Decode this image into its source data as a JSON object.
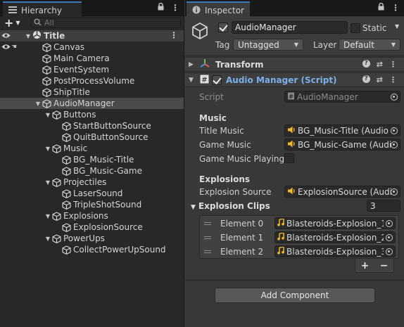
{
  "hierarchy": {
    "tab_label": "Hierarchy",
    "search_placeholder": "All",
    "plus_label": "+",
    "root": "Title",
    "items": [
      {
        "label": "Canvas",
        "depth": 1,
        "expanded": null
      },
      {
        "label": "Main Camera",
        "depth": 1,
        "expanded": null
      },
      {
        "label": "EventSystem",
        "depth": 1,
        "expanded": null
      },
      {
        "label": "PostProcessVolume",
        "depth": 1,
        "expanded": null
      },
      {
        "label": "ShipTitle",
        "depth": 1,
        "expanded": null
      },
      {
        "label": "AudioManager",
        "depth": 1,
        "expanded": true,
        "selected": true
      },
      {
        "label": "Buttons",
        "depth": 2,
        "expanded": true
      },
      {
        "label": "StartButtonSource",
        "depth": 3,
        "expanded": null
      },
      {
        "label": "QuitButtonSource",
        "depth": 3,
        "expanded": null
      },
      {
        "label": "Music",
        "depth": 2,
        "expanded": true
      },
      {
        "label": "BG_Music-Title",
        "depth": 3,
        "expanded": null
      },
      {
        "label": "BG_Music-Game",
        "depth": 3,
        "expanded": null
      },
      {
        "label": "Projectiles",
        "depth": 2,
        "expanded": true
      },
      {
        "label": "LaserSound",
        "depth": 3,
        "expanded": null
      },
      {
        "label": "TripleShotSound",
        "depth": 3,
        "expanded": null
      },
      {
        "label": "Explosions",
        "depth": 2,
        "expanded": true
      },
      {
        "label": "ExplosionSource",
        "depth": 3,
        "expanded": null
      },
      {
        "label": "PowerUps",
        "depth": 2,
        "expanded": true
      },
      {
        "label": "CollectPowerUpSound",
        "depth": 3,
        "expanded": null
      }
    ]
  },
  "inspector": {
    "tab_label": "Inspector",
    "object_name": "AudioManager",
    "static_label": "Static",
    "tag_label": "Tag",
    "tag_value": "Untagged",
    "layer_label": "Layer",
    "layer_value": "Default",
    "transform_label": "Transform",
    "script_component_label": "Audio Manager (Script)",
    "script_label": "Script",
    "script_value": "AudioManager",
    "music_header": "Music",
    "title_music_label": "Title Music",
    "title_music_value": "BG_Music-Title (Audio S",
    "game_music_label": "Game Music",
    "game_music_value": "BG_Music-Game (Audic",
    "game_music_playing_label": "Game Music Playing",
    "explosions_header": "Explosions",
    "explosion_source_label": "Explosion Source",
    "explosion_source_value": "ExplosionSource (Audio",
    "explosion_clips_label": "Explosion Clips",
    "explosion_clips_count": "3",
    "elements": [
      {
        "label": "Element 0",
        "value": "Blasteroids-Explosion_1"
      },
      {
        "label": "Element 1",
        "value": "Blasteroids-Explosion_2"
      },
      {
        "label": "Element 2",
        "value": "Blasteroids-Explosion_3"
      }
    ],
    "plus": "+",
    "minus": "−",
    "add_component_label": "Add Component"
  },
  "colors": {
    "accent_tab": "#3a79bb",
    "script_title": "#7ab0e8",
    "audio_icon": "#f0b82a"
  }
}
